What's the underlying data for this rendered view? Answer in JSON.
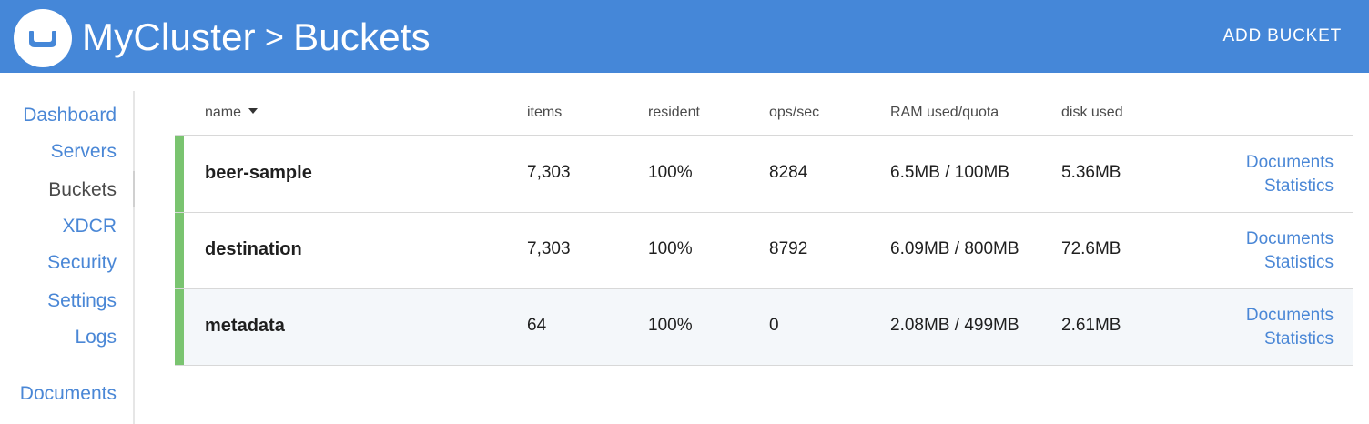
{
  "header": {
    "cluster": "MyCluster",
    "separator": ">",
    "page": "Buckets",
    "add_bucket": "ADD BUCKET"
  },
  "sidebar": {
    "items": [
      {
        "label": "Dashboard",
        "active": false
      },
      {
        "label": "Servers",
        "active": false
      },
      {
        "label": "Buckets",
        "active": true
      },
      {
        "label": "XDCR",
        "active": false
      },
      {
        "label": "Security",
        "active": false
      },
      {
        "label": "Settings",
        "active": false
      },
      {
        "label": "Logs",
        "active": false
      },
      {
        "label": "Documents",
        "active": false
      }
    ]
  },
  "table": {
    "columns": {
      "name": "name",
      "items": "items",
      "resident": "resident",
      "ops": "ops/sec",
      "ram": "RAM used/quota",
      "disk": "disk used"
    },
    "sort": {
      "column": "name",
      "direction": "descending-caret"
    },
    "rows": [
      {
        "name": "beer-sample",
        "items": "7,303",
        "resident": "100%",
        "ops": "8284",
        "ram": "6.5MB / 100MB",
        "disk": "5.36MB",
        "documents": "Documents",
        "statistics": "Statistics",
        "status": "healthy"
      },
      {
        "name": "destination",
        "items": "7,303",
        "resident": "100%",
        "ops": "8792",
        "ram": "6.09MB / 800MB",
        "disk": "72.6MB",
        "documents": "Documents",
        "statistics": "Statistics",
        "status": "healthy"
      },
      {
        "name": "metadata",
        "items": "64",
        "resident": "100%",
        "ops": "0",
        "ram": "2.08MB / 499MB",
        "disk": "2.61MB",
        "documents": "Documents",
        "statistics": "Statistics",
        "status": "healthy"
      }
    ]
  },
  "colors": {
    "header_bg": "#4587d8",
    "link": "#4a87d6",
    "status_healthy": "#7ac470",
    "row_alt_bg": "#f4f7fa"
  },
  "icons": {
    "logo": "couchbase-logo-icon",
    "sort": "caret-down-icon"
  }
}
